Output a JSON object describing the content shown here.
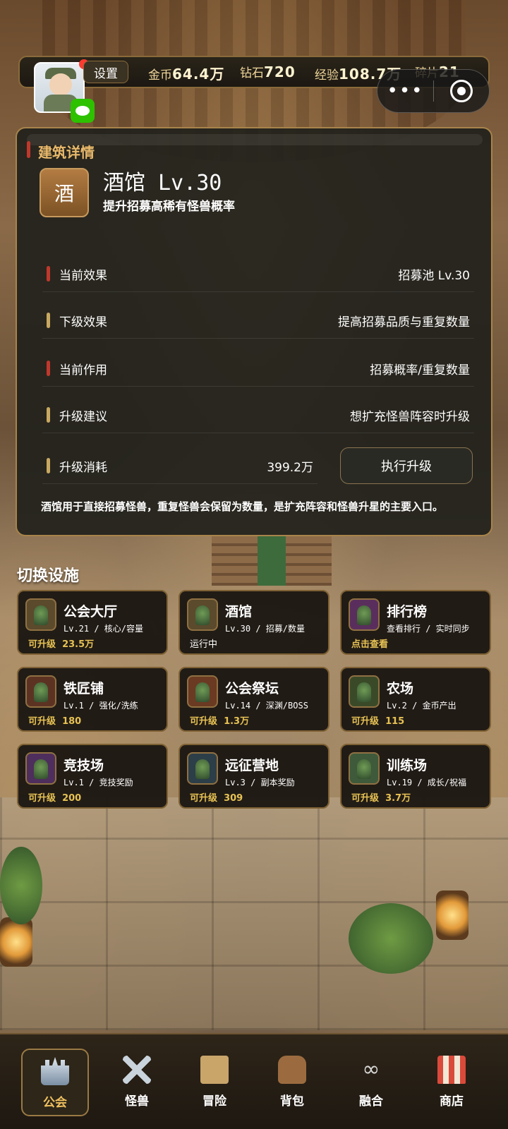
{
  "topbar": {
    "settings_label": "设置",
    "resources": [
      {
        "label": "金币",
        "value": "64.4万"
      },
      {
        "label": "钻石",
        "value": "720"
      },
      {
        "label": "经验",
        "value": "108.7万"
      },
      {
        "label": "碎片",
        "value": "21"
      }
    ],
    "capsule_more": "•••"
  },
  "panel": {
    "title": "建筑详情",
    "icon_char": "酒",
    "name": "酒馆 Lv.30",
    "desc": "提升招募高稀有怪兽概率",
    "rows": [
      {
        "label": "当前效果",
        "value": "招募池 Lv.30"
      },
      {
        "label": "下级效果",
        "value": "提高招募品质与重复数量"
      },
      {
        "label": "当前作用",
        "value": "招募概率/重复数量"
      },
      {
        "label": "升级建议",
        "value": "想扩充怪兽阵容时升级"
      },
      {
        "label": "升级消耗",
        "value": "399.2万"
      }
    ],
    "upgrade_button": "执行升级",
    "note": "酒馆用于直接招募怪兽，重复怪兽会保留为数量，是扩充阵容和怪兽升星的主要入口。"
  },
  "facilities": {
    "title": "切换设施",
    "items": [
      {
        "name": "公会大厅",
        "sub": "Lv.21 / 核心/容量",
        "status": "可升级",
        "cost": "23.5万"
      },
      {
        "name": "酒馆",
        "sub": "Lv.30 / 招募/数量",
        "status": "运行中",
        "cost": ""
      },
      {
        "name": "排行榜",
        "sub": "查看排行 / 实时同步",
        "status": "点击查看",
        "cost": ""
      },
      {
        "name": "铁匠铺",
        "sub": "Lv.1 / 强化/洗练",
        "status": "可升级",
        "cost": "180"
      },
      {
        "name": "公会祭坛",
        "sub": "Lv.14 / 深渊/BOSS",
        "status": "可升级",
        "cost": "1.3万"
      },
      {
        "name": "农场",
        "sub": "Lv.2 / 金币产出",
        "status": "可升级",
        "cost": "115"
      },
      {
        "name": "竞技场",
        "sub": "Lv.1 / 竞技奖励",
        "status": "可升级",
        "cost": "200"
      },
      {
        "name": "远征营地",
        "sub": "Lv.3 / 副本奖励",
        "status": "可升级",
        "cost": "309"
      },
      {
        "name": "训练场",
        "sub": "Lv.19 / 成长/祝福",
        "status": "可升级",
        "cost": "3.7万"
      }
    ]
  },
  "nav": {
    "items": [
      {
        "label": "公会",
        "icon": "castle-icon"
      },
      {
        "label": "怪兽",
        "icon": "crossed-swords-icon"
      },
      {
        "label": "冒险",
        "icon": "map-scroll-icon"
      },
      {
        "label": "背包",
        "icon": "backpack-icon"
      },
      {
        "label": "融合",
        "icon": "infinity-icon"
      },
      {
        "label": "商店",
        "icon": "shop-stall-icon"
      }
    ],
    "active": "公会"
  },
  "colors": {
    "accent_gold": "#e9b96b",
    "status_yellow": "#e7c254",
    "panel_border": "#a8844b",
    "red_marker": "#c0382c"
  }
}
